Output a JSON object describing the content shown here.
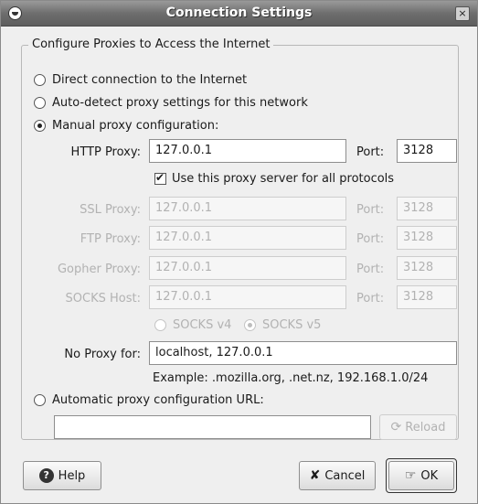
{
  "window": {
    "title": "Connection Settings",
    "close_label": "×"
  },
  "frame": {
    "legend": "Configure Proxies to Access the Internet"
  },
  "options": {
    "direct": "Direct connection to the Internet",
    "autodetect": "Auto-detect proxy settings for this network",
    "manual": "Manual proxy configuration:",
    "auto_url": "Automatic proxy configuration URL:"
  },
  "manual": {
    "http": {
      "label": "HTTP Proxy:",
      "value": "127.0.0.1",
      "port_label": "Port:",
      "port": "3128"
    },
    "use_same_label": "Use this proxy server for all protocols",
    "ssl": {
      "label": "SSL Proxy:",
      "value": "127.0.0.1",
      "port_label": "Port:",
      "port": "3128"
    },
    "ftp": {
      "label": "FTP Proxy:",
      "value": "127.0.0.1",
      "port_label": "Port:",
      "port": "3128"
    },
    "gopher": {
      "label": "Gopher Proxy:",
      "value": "127.0.0.1",
      "port_label": "Port:",
      "port": "3128"
    },
    "socks": {
      "label": "SOCKS Host:",
      "value": "127.0.0.1",
      "port_label": "Port:",
      "port": "3128"
    },
    "socks_v4": "SOCKS v4",
    "socks_v5": "SOCKS v5",
    "no_proxy": {
      "label": "No Proxy for:",
      "value": "localhost, 127.0.0.1"
    },
    "example": "Example: .mozilla.org, .net.nz, 192.168.1.0/24"
  },
  "auto_url": {
    "value": "",
    "reload_label": "Reload"
  },
  "buttons": {
    "help": "Help",
    "cancel": "Cancel",
    "ok": "OK"
  },
  "selected": "manual"
}
